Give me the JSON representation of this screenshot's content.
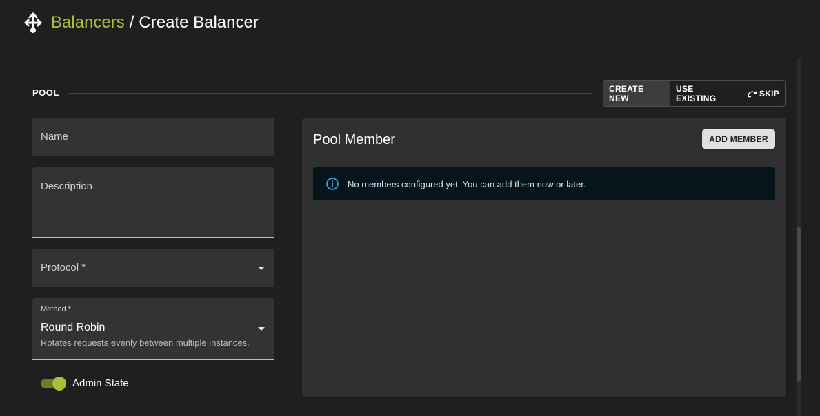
{
  "header": {
    "breadcrumb_link": "Balancers",
    "breadcrumb_sep": "/",
    "breadcrumb_current": "Create Balancer"
  },
  "pool": {
    "section_label": "POOL",
    "mode_buttons": {
      "create_new": "CREATE NEW",
      "use_existing": "USE EXISTING",
      "skip": "SKIP"
    },
    "active_mode": "create_new"
  },
  "form": {
    "name_placeholder": "Name",
    "description_placeholder": "Description",
    "protocol_placeholder": "Protocol *",
    "method": {
      "label": "Method *",
      "value": "Round Robin",
      "hint": "Rotates requests evenly between multiple instances."
    },
    "admin_state": {
      "label": "Admin State",
      "enabled": true
    }
  },
  "pool_member": {
    "title": "Pool Member",
    "add_button": "ADD MEMBER",
    "empty_message": "No members configured yet. You can add them now or later."
  },
  "colors": {
    "accent": "#a6c13a",
    "background": "#1f1f1f",
    "surface": "#333333",
    "alert_bg": "#07141c",
    "info": "#3aa0d8"
  },
  "icons": {
    "logo": "arrows-split-icon",
    "skip": "skip-arrow-icon",
    "info": "info-icon",
    "caret": "caret-down-icon"
  }
}
